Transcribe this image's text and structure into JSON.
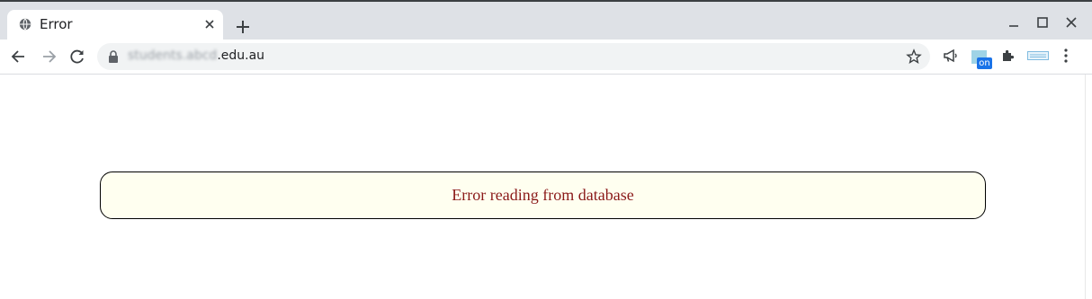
{
  "browser": {
    "tab": {
      "title": "Error",
      "icon": "globe-icon"
    },
    "window_controls": [
      "minimize-icon",
      "maximize-icon",
      "close-icon"
    ],
    "nav": {
      "back": "arrow-left-icon",
      "forward": "arrow-right-icon",
      "reload": "reload-icon"
    },
    "address": {
      "host_blurred": "students.abcd",
      "host_visible": ".edu.au",
      "secure_icon": "lock-icon"
    },
    "extensions": [
      {
        "name": "megaphone-icon"
      },
      {
        "name": "on-badge-extension",
        "badge": "on"
      },
      {
        "name": "puzzle-icon"
      },
      {
        "name": "blue-extension"
      },
      {
        "name": "kebab-menu-icon"
      }
    ]
  },
  "page": {
    "error_message": "Error reading from database",
    "colors": {
      "box_bg": "#fffff0",
      "text": "#8b1a1a",
      "border": "#000000"
    }
  }
}
